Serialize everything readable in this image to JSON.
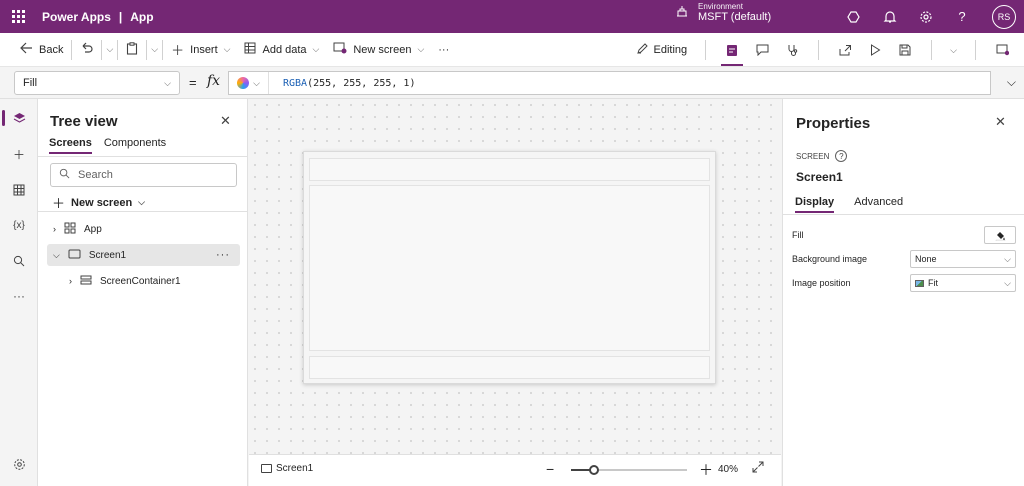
{
  "app": {
    "brand": "Power Apps",
    "separator": "|",
    "name": "App"
  },
  "environment": {
    "label": "Environment",
    "name": "MSFT (default)"
  },
  "user": {
    "initials": "RS"
  },
  "commands": {
    "back": "Back",
    "insert": "Insert",
    "add_data": "Add data",
    "new_screen": "New screen",
    "more": "···",
    "editing": "Editing"
  },
  "formula": {
    "property": "Fill",
    "equals": "=",
    "fx": "fx",
    "function": "RGBA",
    "args": "(255, 255, 255, 1)"
  },
  "tree": {
    "title": "Tree view",
    "tabs": [
      "Screens",
      "Components"
    ],
    "search_placeholder": "Search",
    "new_screen": "New screen",
    "nodes": [
      {
        "label": "App"
      },
      {
        "label": "Screen1"
      },
      {
        "label": "ScreenContainer1"
      }
    ],
    "more": "···"
  },
  "status": {
    "screen_name": "Screen1",
    "zoom": "40%",
    "zoom_fraction": 0.4
  },
  "properties": {
    "title": "Properties",
    "type": "SCREEN",
    "name": "Screen1",
    "tabs": [
      "Display",
      "Advanced"
    ],
    "rows": {
      "fill": {
        "label": "Fill"
      },
      "background_image": {
        "label": "Background image",
        "value": "None"
      },
      "image_position": {
        "label": "Image position",
        "value": "Fit"
      }
    }
  },
  "colors": {
    "brand": "#742774",
    "formula_function": "#1a5fb4"
  }
}
